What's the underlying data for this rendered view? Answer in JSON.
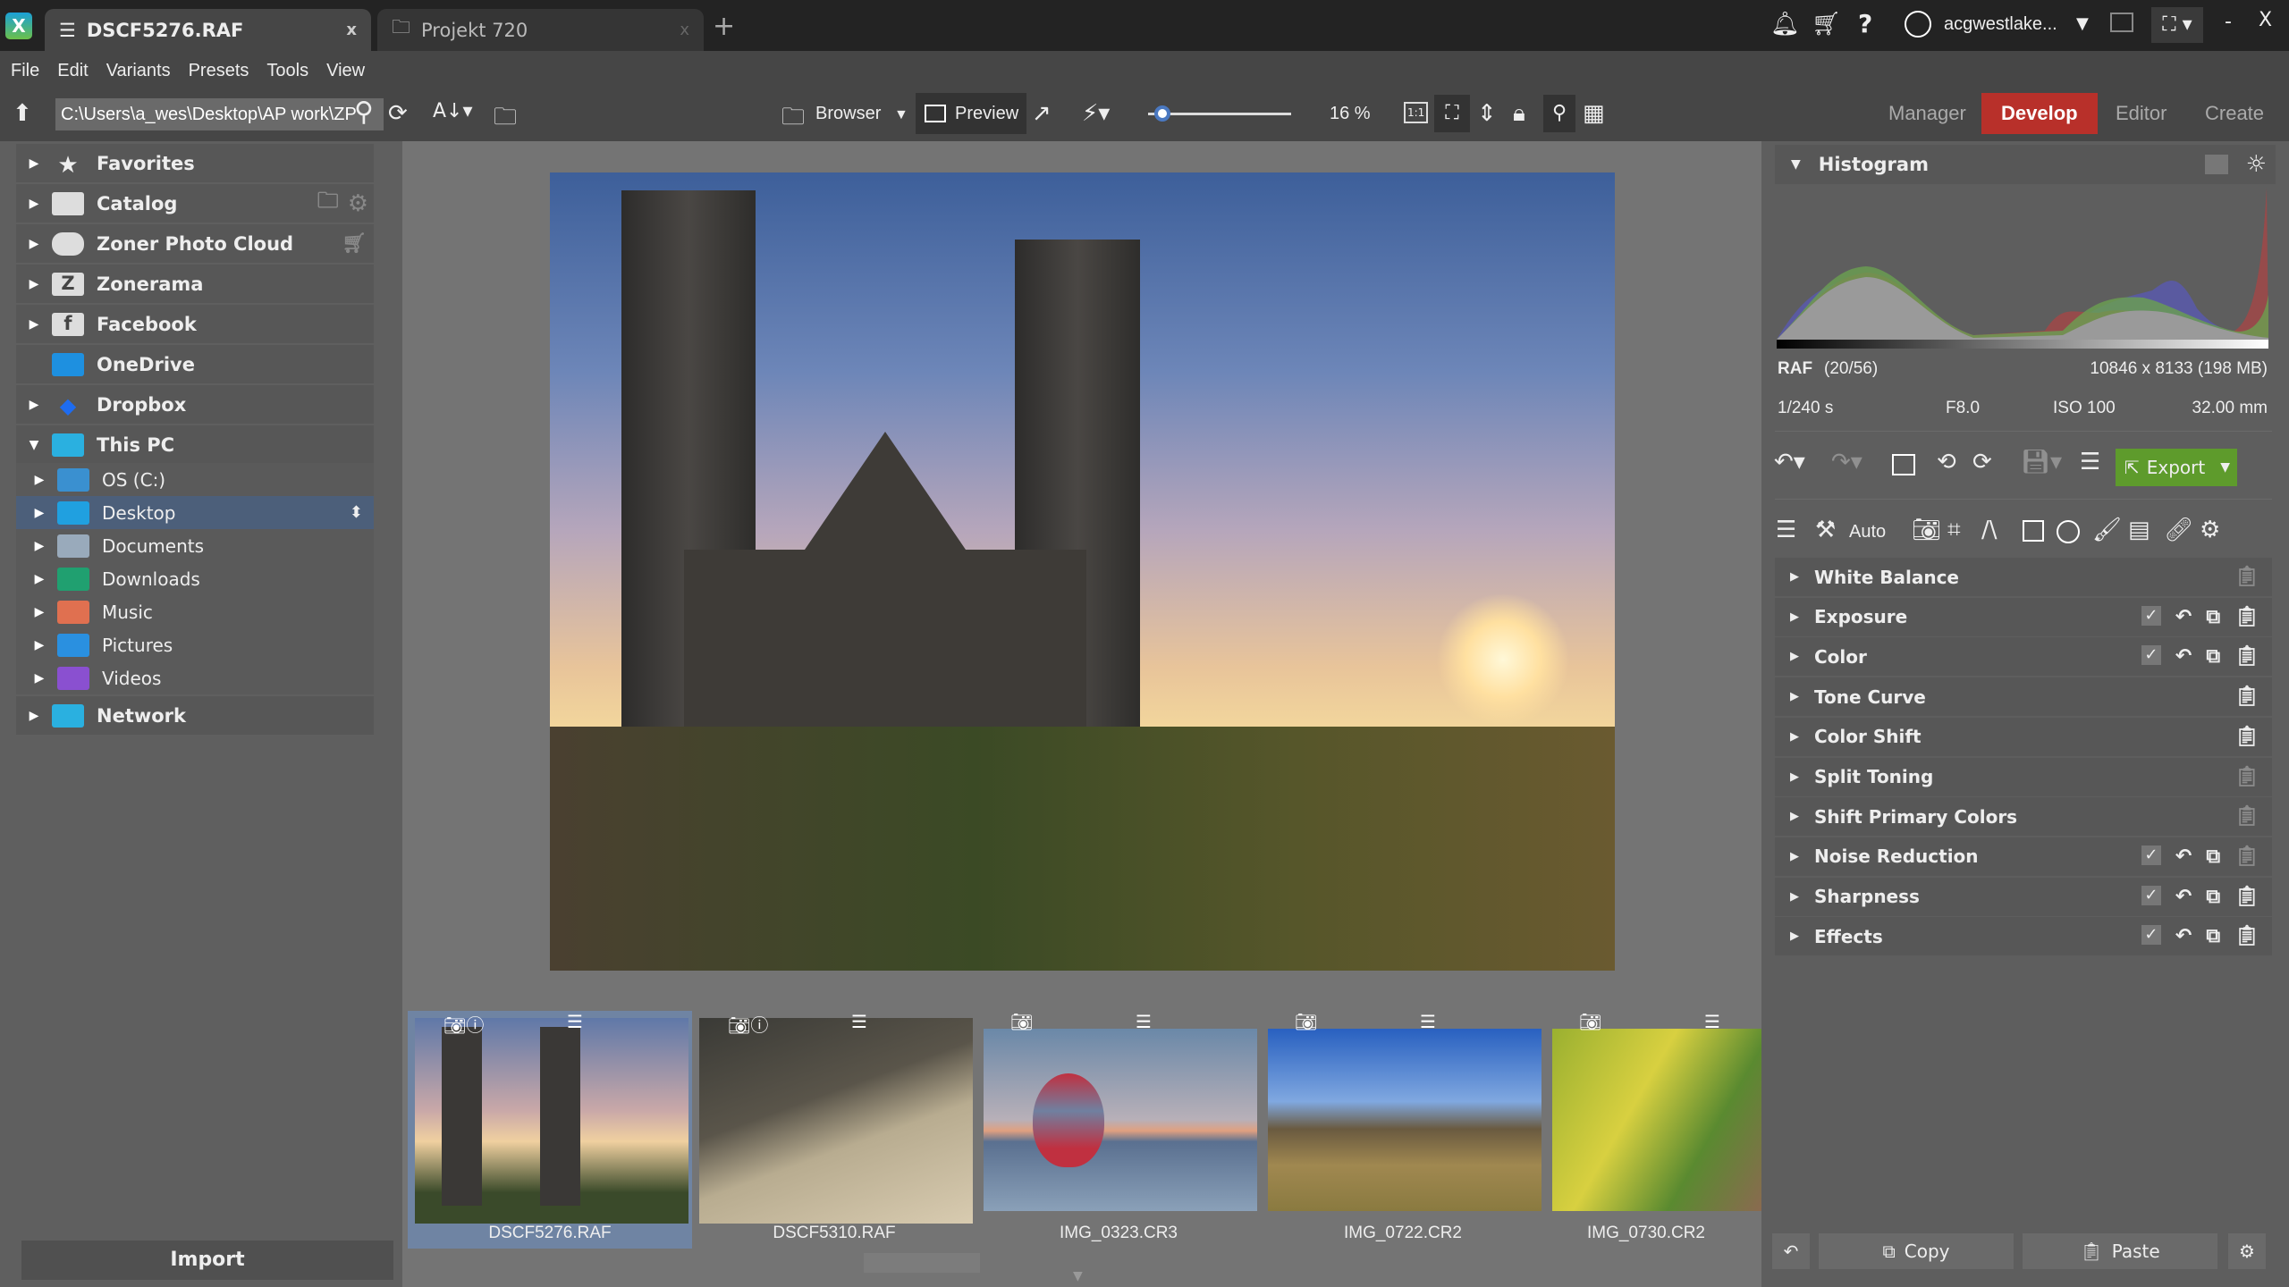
{
  "window": {
    "user": "acgwestlake...",
    "tabs": [
      {
        "label": "DSCF5276.RAF",
        "close": "x"
      },
      {
        "label": "Projekt 720",
        "close": "x"
      }
    ],
    "new_tab": "+",
    "minimize": "-",
    "close": "X"
  },
  "menu": [
    "File",
    "Edit",
    "Variants",
    "Presets",
    "Tools",
    "View"
  ],
  "toolbar": {
    "path": "C:\\Users\\a_wes\\Desktop\\AP work\\ZP",
    "browser": "Browser",
    "preview": "Preview",
    "zoom": "16 %",
    "zoom_fraction": 0.05,
    "one_to_one": "1:1"
  },
  "modules": {
    "items": [
      "Manager",
      "Develop",
      "Editor",
      "Create"
    ],
    "active": "Develop",
    "accent": "#b8302a"
  },
  "sidebar": {
    "items": [
      {
        "label": "Favorites"
      },
      {
        "label": "Catalog"
      },
      {
        "label": "Zoner Photo Cloud"
      },
      {
        "label": "Zonerama"
      },
      {
        "label": "Facebook"
      },
      {
        "label": "OneDrive"
      },
      {
        "label": "Dropbox"
      },
      {
        "label": "This PC"
      }
    ],
    "pc": [
      {
        "label": "OS (C:)"
      },
      {
        "label": "Desktop"
      },
      {
        "label": "Documents"
      },
      {
        "label": "Downloads"
      },
      {
        "label": "Music"
      },
      {
        "label": "Pictures"
      },
      {
        "label": "Videos"
      }
    ],
    "network": "Network",
    "import": "Import",
    "selected": "Desktop"
  },
  "filmstrip": [
    {
      "name": "DSCF5276.RAF"
    },
    {
      "name": "DSCF5310.RAF"
    },
    {
      "name": "IMG_0323.CR3"
    },
    {
      "name": "IMG_0722.CR2"
    },
    {
      "name": "IMG_0730.CR2"
    }
  ],
  "histogram": {
    "title": "Histogram",
    "format": "RAF",
    "index": "(20/56)",
    "dimensions": "10846 x 8133 (198 MB)",
    "shutter": "1/240 s",
    "aperture": "F8.0",
    "iso": "ISO 100",
    "focal": "32.00 mm"
  },
  "develop": {
    "export": "Export",
    "export_color": "#5e9b2c",
    "auto": "Auto",
    "sections": [
      {
        "label": "White Balance",
        "active": false
      },
      {
        "label": "Exposure",
        "active": true
      },
      {
        "label": "Color",
        "active": true
      },
      {
        "label": "Tone Curve",
        "active": false
      },
      {
        "label": "Color Shift",
        "active": false
      },
      {
        "label": "Split Toning",
        "active": false
      },
      {
        "label": "Shift Primary Colors",
        "active": false
      },
      {
        "label": "Noise Reduction",
        "active": true
      },
      {
        "label": "Sharpness",
        "active": true
      },
      {
        "label": "Effects",
        "active": true
      }
    ],
    "copy": "Copy",
    "paste": "Paste"
  }
}
